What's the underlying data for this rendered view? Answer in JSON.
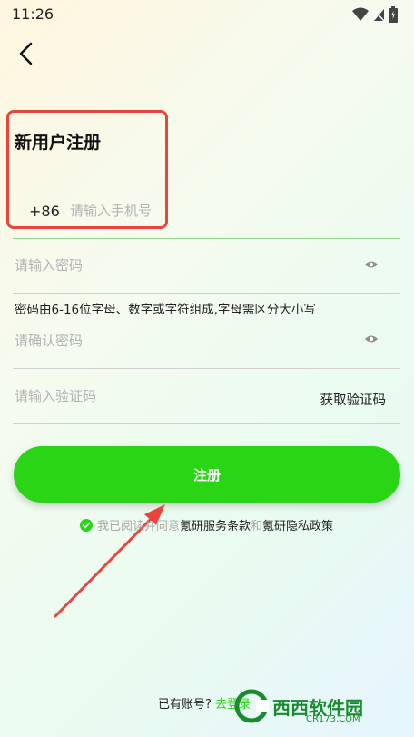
{
  "status_bar": {
    "time": "11:26"
  },
  "page": {
    "title": "新用户注册"
  },
  "phone": {
    "country_code": "+86",
    "placeholder": "请输入手机号"
  },
  "password": {
    "placeholder": "请输入密码",
    "hint": "密码由6-16位字母、数字或字符组成,字母需区分大小写"
  },
  "confirm_password": {
    "placeholder": "请确认密码"
  },
  "verification": {
    "placeholder": "请输入验证码",
    "get_code_label": "获取验证码"
  },
  "register_button": {
    "label": "注册"
  },
  "agreement": {
    "prefix": "我已阅读并同意",
    "terms": "氪研服务条款",
    "and": "和",
    "privacy": "氪研隐私政策"
  },
  "login": {
    "prompt": "已有账号?",
    "link": "去登录"
  },
  "watermark": {
    "text": "西西软件园",
    "url": "CR173.COM"
  },
  "colors": {
    "accent": "#2ad516",
    "highlight": "#e8453c"
  },
  "icons": [
    "wifi-icon",
    "no-sim-icon",
    "battery-icon",
    "back-arrow-icon",
    "eye-icon",
    "check-circle-icon"
  ]
}
